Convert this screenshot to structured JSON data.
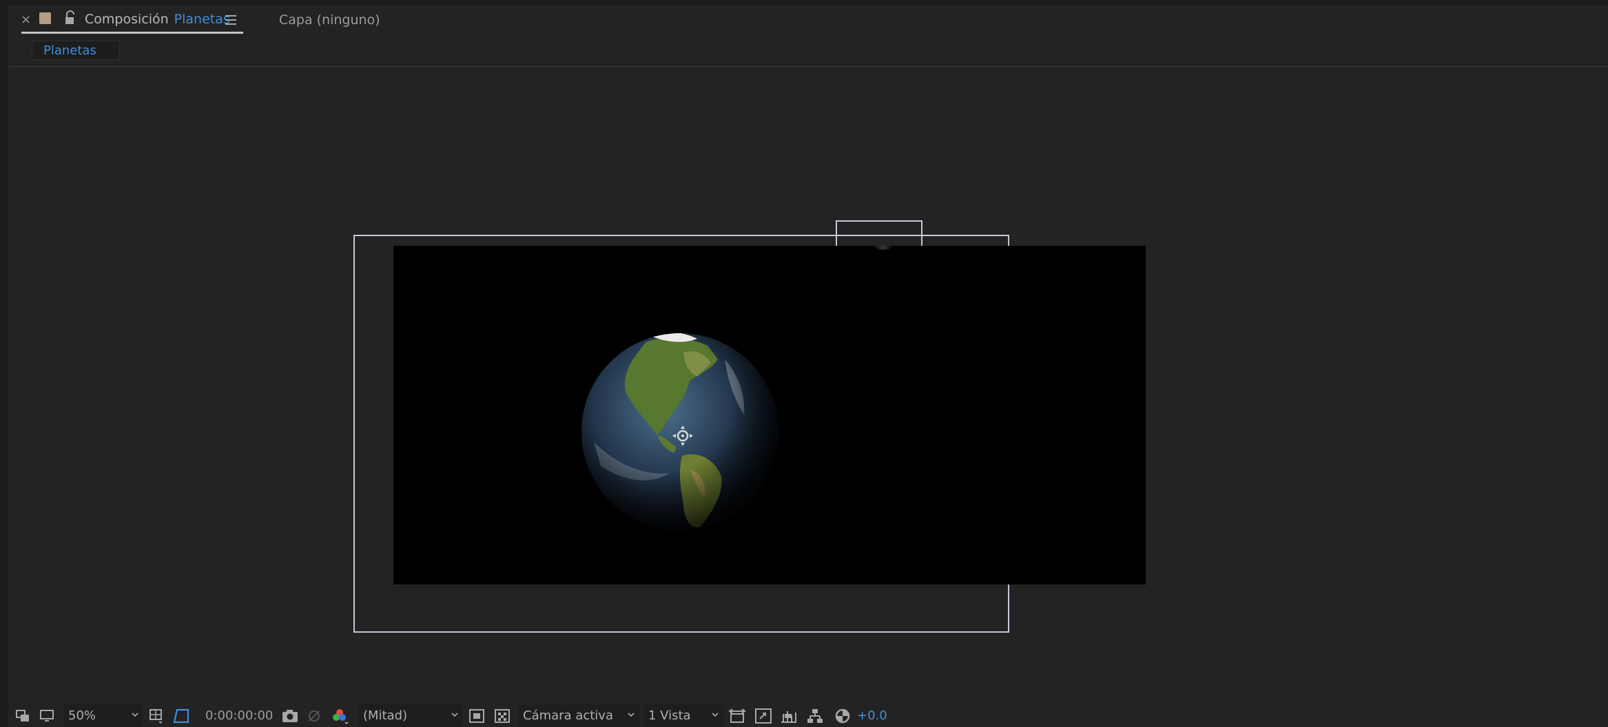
{
  "header": {
    "close_glyph": "×",
    "comp_tab_prefix": "Composición",
    "comp_tab_name": "Planetas",
    "layer_tab": "Capa (ninguno)",
    "breadcrumb": "Planetas"
  },
  "toolbar": {
    "zoom": "50%",
    "timecode": "0:00:00:00",
    "resolution": "(Mitad)",
    "camera": "Cámara activa",
    "views": "1 Vista",
    "exposure": "+0.0"
  },
  "colors": {
    "accent": "#3f8fdc",
    "label_color": "#b79d84",
    "panel_bg": "#232323",
    "frame": "#c4c8d8"
  },
  "icons": [
    "close-icon",
    "label-color-swatch",
    "unlock-icon",
    "panel-menu-icon",
    "always-preview-icon",
    "monitor-icon",
    "chevron-down-icon",
    "region-of-interest-icon",
    "transparency-grid-icon",
    "snapshot-icon",
    "show-snapshot-icon",
    "color-channels-icon",
    "fast-preview-icon",
    "toggle-transparency-grid-icon",
    "reset-exposure-icon",
    "3d-view-icon",
    "flowchart-icon",
    "adjust-exposure-icon",
    "anchor-point-icon"
  ]
}
